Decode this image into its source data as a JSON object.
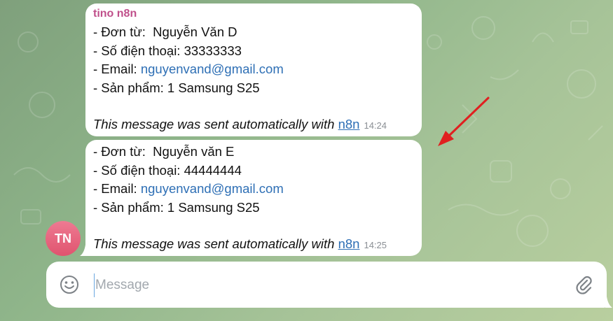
{
  "messages": [
    {
      "sender": "tino n8n",
      "lines": [
        "- Đơn từ:  Nguyễn Văn D",
        "- Số điện thoại: 33333333"
      ],
      "email_prefix": "- Email: ",
      "email": "nguyenvand@gmail.com",
      "product": "- Sản phẩm: 1 Samsung S25",
      "footer_text": "This message was sent automatically with ",
      "footer_link": "n8n",
      "time": "14:24"
    },
    {
      "lines": [
        "- Đơn từ:  Nguyễn văn E",
        "- Số điện thoại: 44444444"
      ],
      "email_prefix": "- Email: ",
      "email": "nguyenvand@gmail.com",
      "product": "- Sản phẩm: 1 Samsung S25",
      "footer_text": "This message was sent automatically with ",
      "footer_link": "n8n",
      "time": "14:25"
    }
  ],
  "avatar": {
    "initials": "TN"
  },
  "composer": {
    "placeholder": "Message"
  },
  "icons": {
    "emoji": "smile-icon",
    "attach": "paperclip-icon",
    "annotation": "red-arrow-icon"
  },
  "colors": {
    "sender": "#c0508b",
    "link": "#2e6fb5",
    "avatar": "#e0546f",
    "arrow": "#e02020"
  }
}
